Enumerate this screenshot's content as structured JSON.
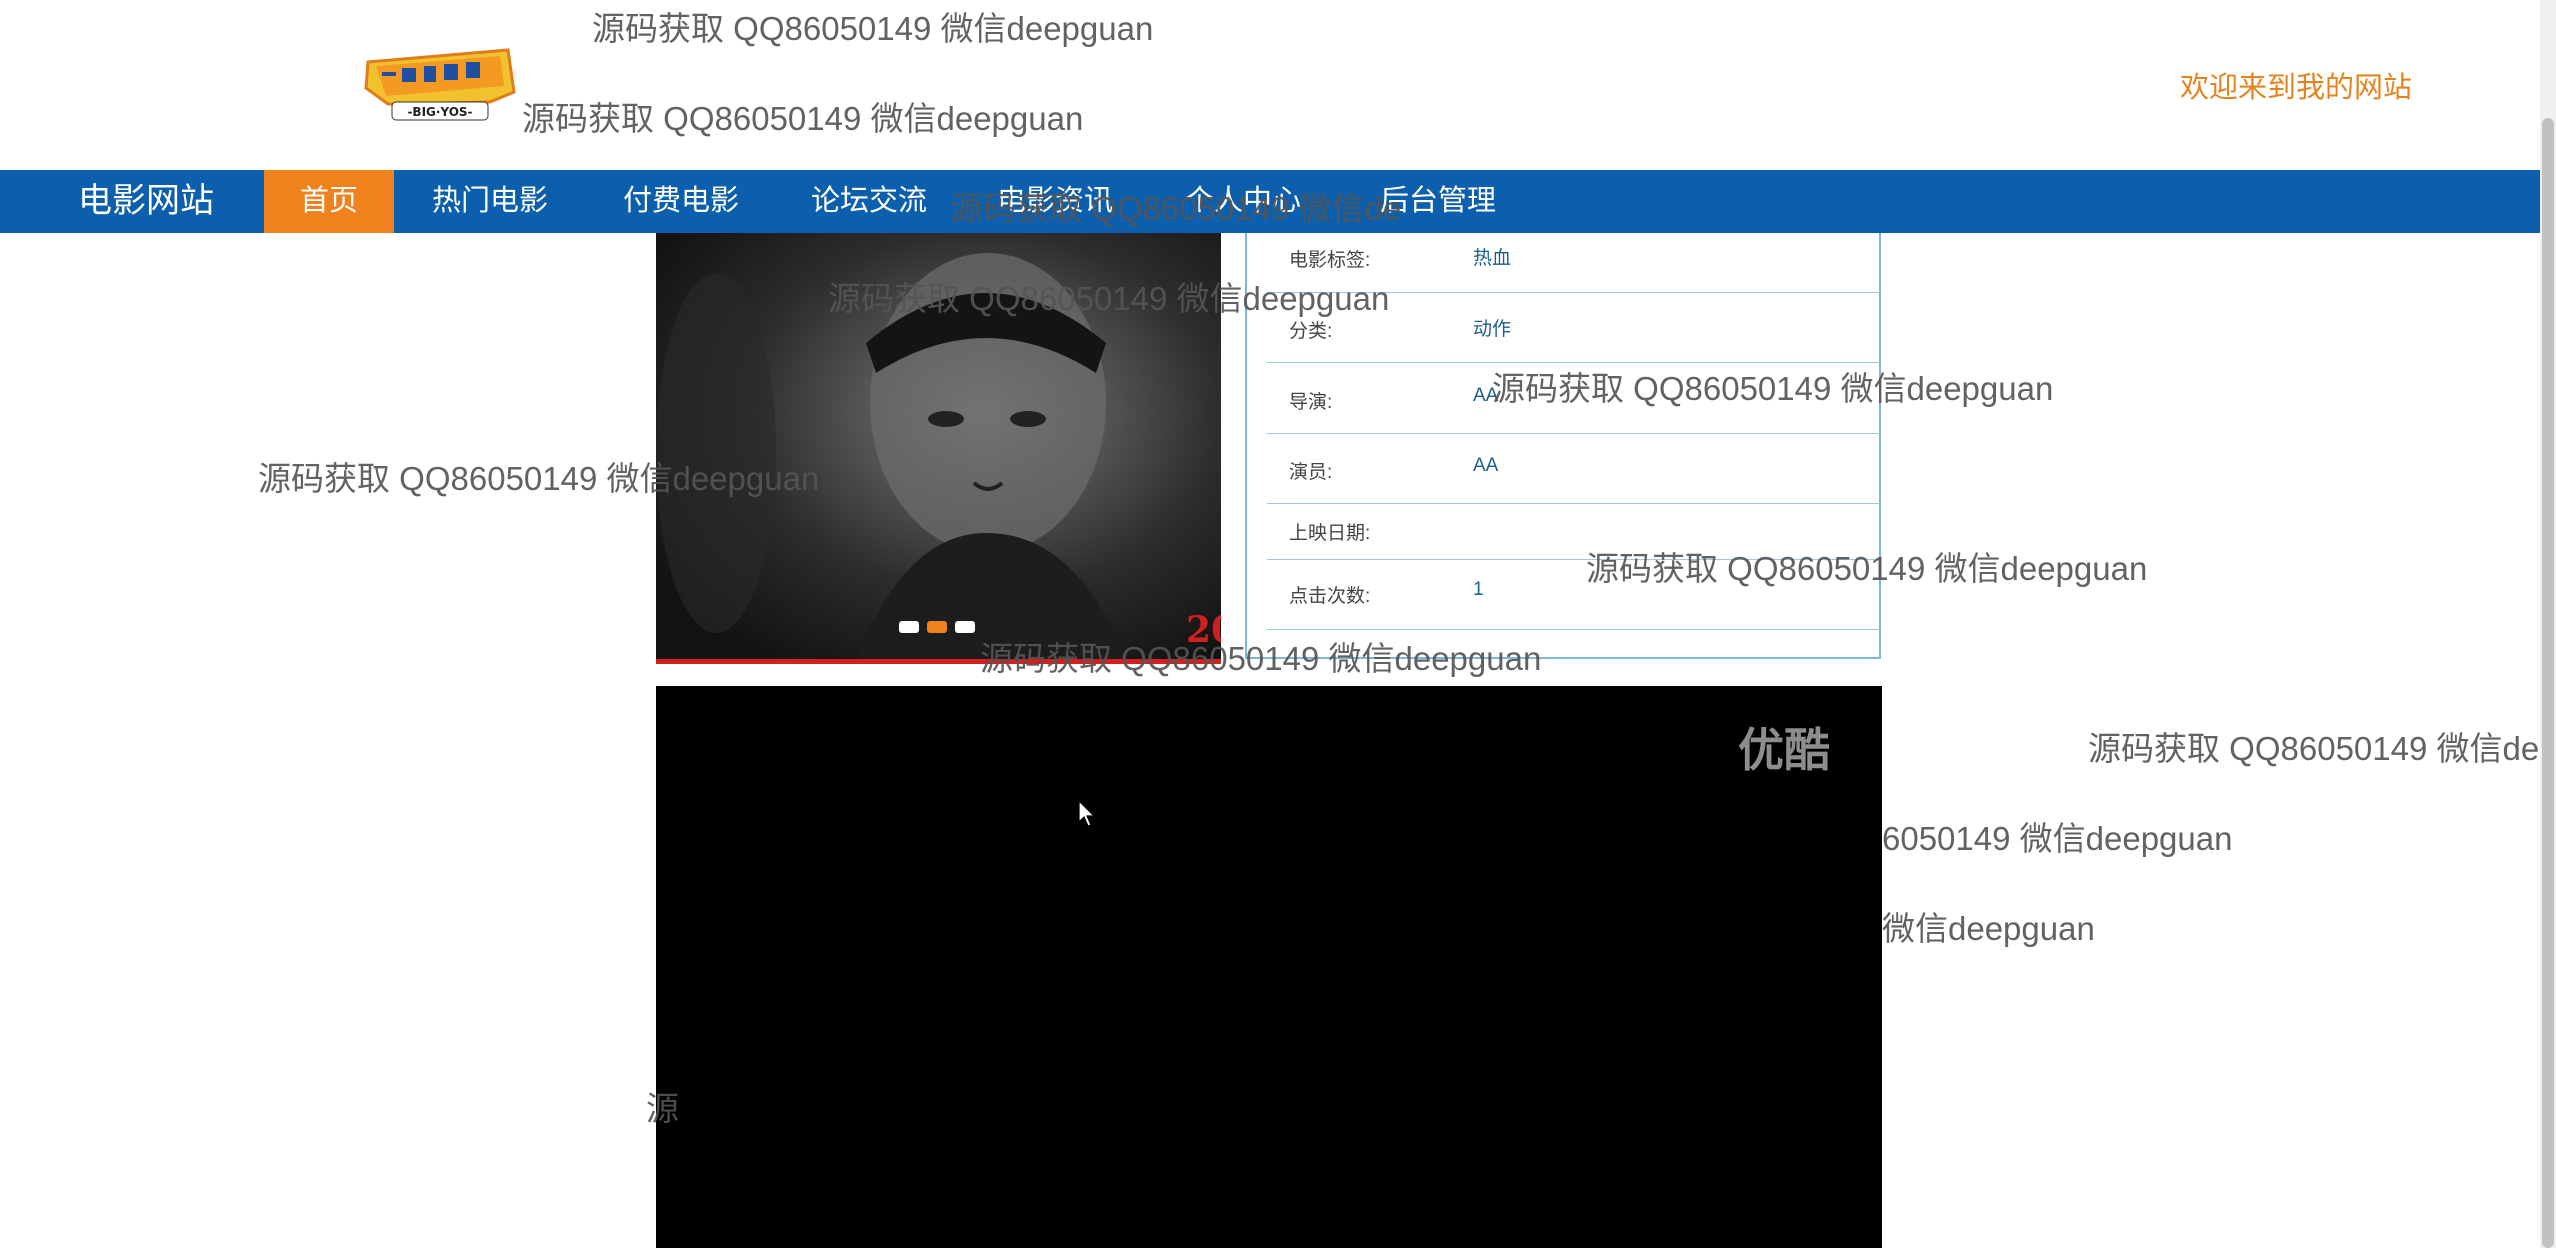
{
  "header": {
    "welcome": "欢迎来到我的网站"
  },
  "nav": {
    "brand": "电影网站",
    "items": [
      {
        "label": "首页",
        "active": true
      },
      {
        "label": "热门电影"
      },
      {
        "label": "付费电影"
      },
      {
        "label": "论坛交流"
      },
      {
        "label": "电影资讯"
      },
      {
        "label": "个人中心"
      },
      {
        "label": "后台管理"
      }
    ]
  },
  "movie": {
    "rows": [
      {
        "key": "电影标签:",
        "value": "热血"
      },
      {
        "key": "分类:",
        "value": "动作"
      },
      {
        "key": "导演:",
        "value": "AA"
      },
      {
        "key": "演员:",
        "value": "AA"
      },
      {
        "key": "上映日期:",
        "value": ""
      },
      {
        "key": "点击次数:",
        "value": "1"
      }
    ],
    "poster_year_fragment": "20",
    "carousel_active_index": 1,
    "carousel_count": 3
  },
  "video": {
    "brand": "优酷"
  },
  "watermark": {
    "text": "源码获取 QQ86050149 微信deepguan",
    "partial_1": "6050149 微信deepguan",
    "partial_2": "微信deepguan",
    "partial_3": "源码获取 QQ86050149 微信deep",
    "partial_4": "源码获取 QQ86050149 微信de",
    "partial_5": "源"
  },
  "colors": {
    "nav_bg": "#0b5fac",
    "nav_active": "#f0821e",
    "welcome": "#e4841f",
    "panel_border": "#7fb7d6",
    "value_text": "#1c5f8c"
  }
}
